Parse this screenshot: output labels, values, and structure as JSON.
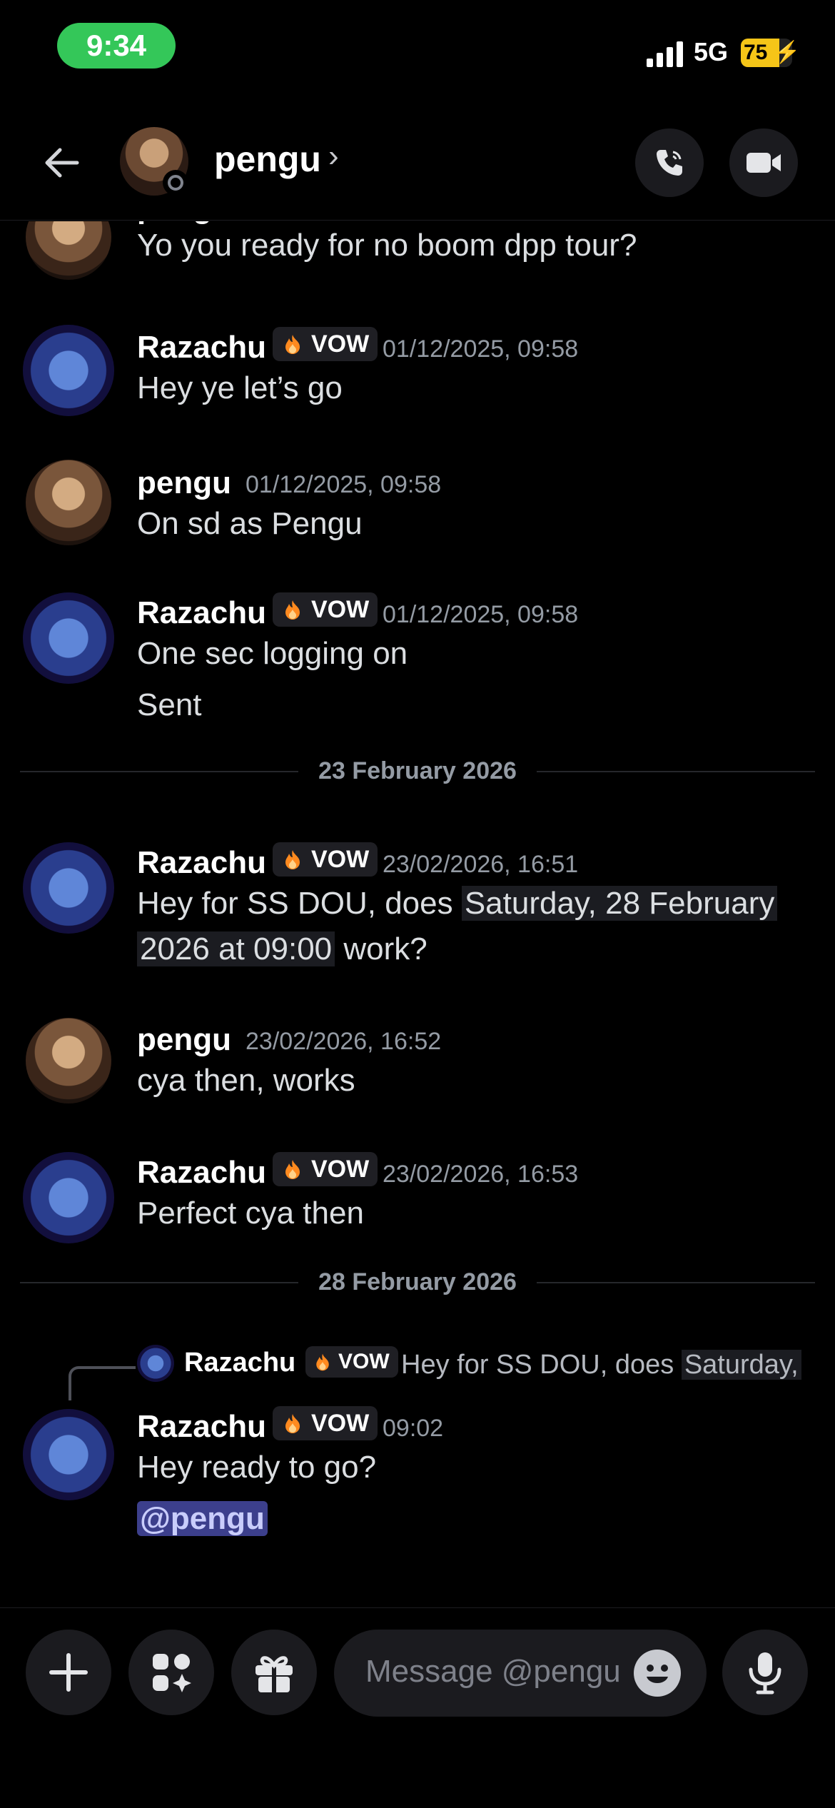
{
  "status_bar": {
    "time": "9:34",
    "network": "5G",
    "battery": "75",
    "battery_level": 0.75
  },
  "header": {
    "name": "pengu",
    "chevron": "›"
  },
  "messages": [
    {
      "author": "pengu",
      "text": "Yo you ready for no boom dpp tour?"
    },
    {
      "author": "Razachu",
      "tag": "VOW",
      "timestamp": "01/12/2025, 09:58",
      "text": "Hey ye let’s go"
    },
    {
      "author": "pengu",
      "timestamp": "01/12/2025, 09:58",
      "text": "On sd as Pengu"
    },
    {
      "author": "Razachu",
      "tag": "VOW",
      "timestamp": "01/12/2025, 09:58",
      "text": "One sec logging on",
      "text2": "Sent"
    },
    {
      "author": "Razachu",
      "tag": "VOW",
      "timestamp": "23/02/2026, 16:51",
      "text_a": "Hey for SS DOU, does ",
      "text_b": "Saturday, 28 February",
      "text_c": "2026 at 09:00",
      "text_d": " work?"
    },
    {
      "author": "pengu",
      "timestamp": "23/02/2026, 16:52",
      "text": "cya then, works"
    },
    {
      "author": "Razachu",
      "tag": "VOW",
      "timestamp": "23/02/2026, 16:53",
      "text": "Perfect cya then"
    },
    {
      "author": "Razachu",
      "tag": "VOW",
      "timestamp": "09:02",
      "text": "Hey ready to go?",
      "mention": "@pengu",
      "reply": {
        "author": "Razachu",
        "tag": "VOW",
        "text_a": "Hey for SS DOU, does ",
        "text_b": "Saturday,"
      }
    }
  ],
  "dividers": [
    "23 February 2026",
    "28 February 2026"
  ],
  "composer": {
    "placeholder": "Message @pengu"
  },
  "icons": {
    "back": "back-arrow-icon",
    "phone": "phone-icon",
    "video": "video-icon",
    "plus": "plus-icon",
    "apps": "apps-icon",
    "gift": "gift-icon",
    "emoji": "emoji-icon",
    "mic": "mic-icon",
    "flame": "flame-icon"
  },
  "colors": {
    "mention_bg": "#3c3f8c",
    "pill_green": "#34c759",
    "battery_yellow": "#f5c518"
  }
}
